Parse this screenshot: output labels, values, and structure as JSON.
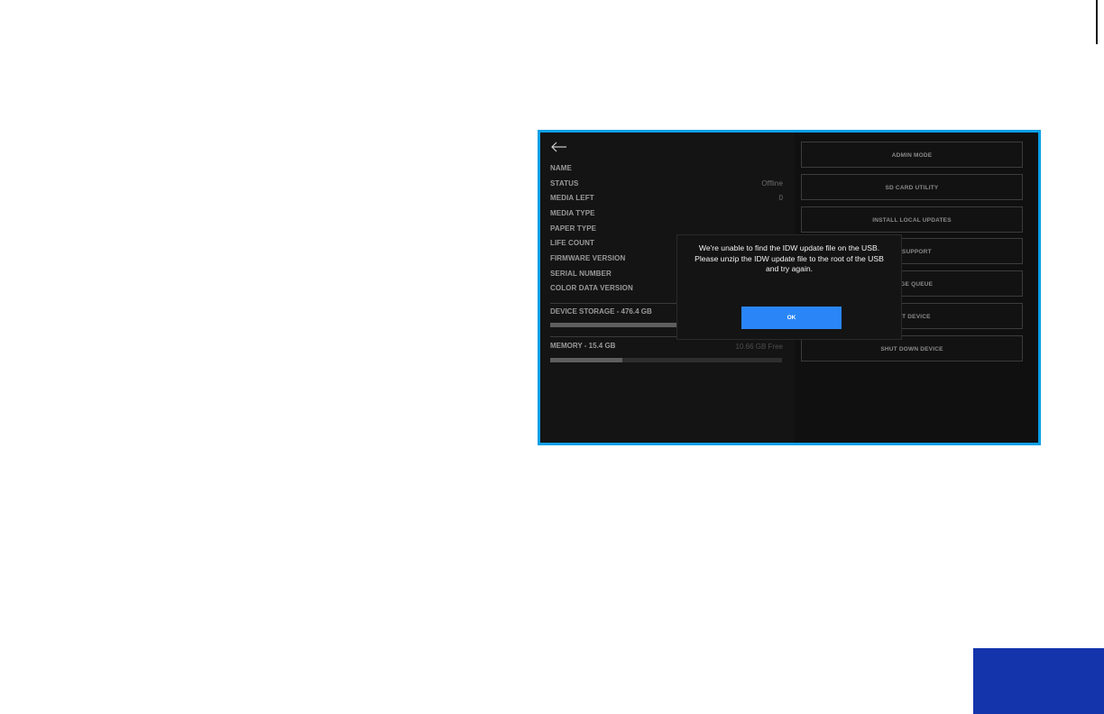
{
  "device_info": {
    "rows": [
      {
        "label": "NAME",
        "value": ""
      },
      {
        "label": "STATUS",
        "value": "Offline"
      },
      {
        "label": "MEDIA LEFT",
        "value": "0"
      },
      {
        "label": "MEDIA TYPE",
        "value": ""
      },
      {
        "label": "PAPER TYPE",
        "value": ""
      },
      {
        "label": "LIFE COUNT",
        "value": ""
      },
      {
        "label": "FIRMWARE VERSION",
        "value": ""
      },
      {
        "label": "SERIAL NUMBER",
        "value": ""
      },
      {
        "label": "COLOR DATA VERSION",
        "value": ""
      }
    ]
  },
  "storage": {
    "label": "DEVICE STORAGE - 476.4 GB",
    "used_fraction": 0.55
  },
  "memory": {
    "label": "MEMORY - 15.4 GB",
    "free_text": "10.66 GB Free",
    "used_fraction": 0.31
  },
  "actions": {
    "admin_mode": "ADMIN MODE",
    "sd_card_utility": "SD CARD UTILITY",
    "install_local_updates": "INSTALL LOCAL UPDATES",
    "remote_support": "TE SUPPORT",
    "image_queue": "MAGE QUEUE",
    "restart_device": "ART DEVICE",
    "shut_down_device": "SHUT DOWN DEVICE"
  },
  "dialog": {
    "message": "We're unable to find the IDW update file on the USB. Please unzip the IDW update file to the root of the USB and try again.",
    "ok_label": "OK"
  },
  "icons": {
    "back": "back-arrow-icon"
  },
  "colors": {
    "frame_border": "#0aa0e6",
    "ok_button": "#2a86f6",
    "corner_block": "#1334ab"
  }
}
